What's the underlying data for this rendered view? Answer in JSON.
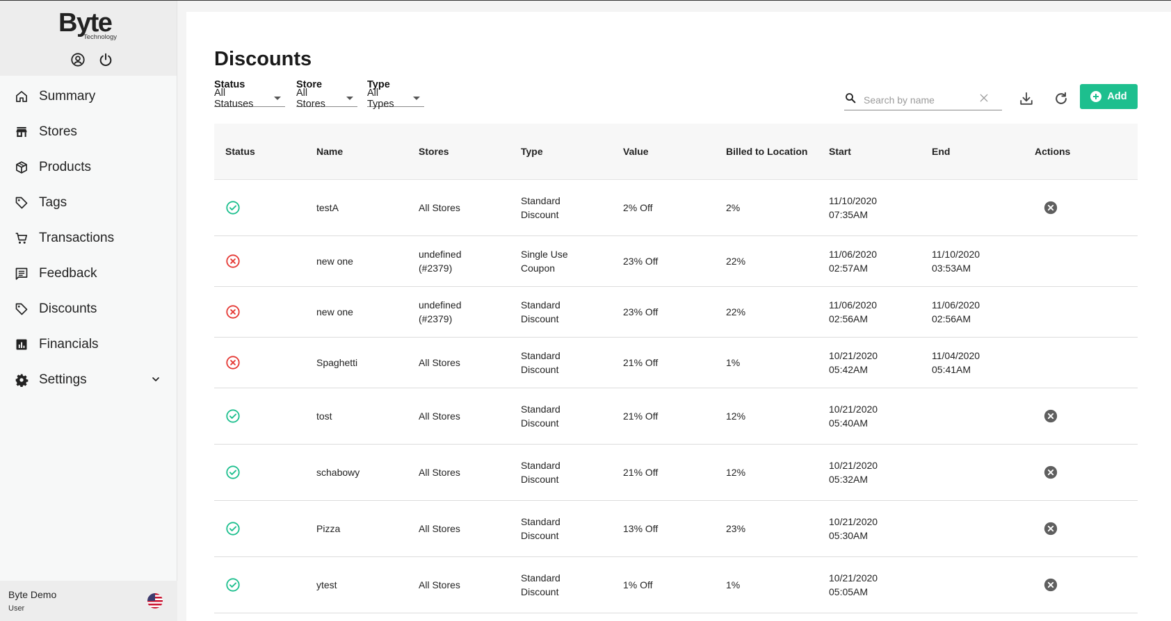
{
  "colors": {
    "accent": "#1dbf8e",
    "active": "#1dbf8e",
    "inactive": "#e53935",
    "action": "#5f5f5f"
  },
  "brand": {
    "name": "Byte",
    "sub": "Technology"
  },
  "sidebar": {
    "items": [
      {
        "label": "Summary",
        "icon": "home-icon"
      },
      {
        "label": "Stores",
        "icon": "store-icon"
      },
      {
        "label": "Products",
        "icon": "box-icon"
      },
      {
        "label": "Tags",
        "icon": "tag-icon"
      },
      {
        "label": "Transactions",
        "icon": "cart-icon"
      },
      {
        "label": "Feedback",
        "icon": "feedback-icon"
      },
      {
        "label": "Discounts",
        "icon": "tag-icon"
      },
      {
        "label": "Financials",
        "icon": "chart-icon"
      },
      {
        "label": "Settings",
        "icon": "gear-icon"
      }
    ],
    "user": {
      "name": "Byte Demo",
      "role": "User"
    }
  },
  "page": {
    "title": "Discounts"
  },
  "filters": {
    "status": {
      "label": "Status",
      "value": "All Statuses"
    },
    "store": {
      "label": "Store",
      "value": "All Stores"
    },
    "type": {
      "label": "Type",
      "value": "All Types"
    }
  },
  "search": {
    "placeholder": "Search by name"
  },
  "add_label": "Add",
  "table": {
    "headers": [
      "Status",
      "Name",
      "Stores",
      "Type",
      "Value",
      "Billed to Location",
      "Start",
      "End",
      "Actions"
    ],
    "rows": [
      {
        "status": "active",
        "name": "testA",
        "stores": "All Stores",
        "type": "Standard Discount",
        "value": "2% Off",
        "billed": "2%",
        "start": "11/10/2020 07:35AM",
        "end": "",
        "action": true
      },
      {
        "status": "inactive",
        "name": "new one",
        "stores": "undefined (#2379)",
        "type": "Single Use Coupon",
        "value": "23% Off",
        "billed": "22%",
        "start": "11/06/2020 02:57AM",
        "end": "11/10/2020 03:53AM",
        "action": false
      },
      {
        "status": "inactive",
        "name": "new one",
        "stores": "undefined (#2379)",
        "type": "Standard Discount",
        "value": "23% Off",
        "billed": "22%",
        "start": "11/06/2020 02:56AM",
        "end": "11/06/2020 02:56AM",
        "action": false
      },
      {
        "status": "inactive",
        "name": "Spaghetti",
        "stores": "All Stores",
        "type": "Standard Discount",
        "value": "21% Off",
        "billed": "1%",
        "start": "10/21/2020 05:42AM",
        "end": "11/04/2020 05:41AM",
        "action": false
      },
      {
        "status": "active",
        "name": "tost",
        "stores": "All Stores",
        "type": "Standard Discount",
        "value": "21% Off",
        "billed": "12%",
        "start": "10/21/2020 05:40AM",
        "end": "",
        "action": true
      },
      {
        "status": "active",
        "name": "schabowy",
        "stores": "All Stores",
        "type": "Standard Discount",
        "value": "21% Off",
        "billed": "12%",
        "start": "10/21/2020 05:32AM",
        "end": "",
        "action": true
      },
      {
        "status": "active",
        "name": "Pizza",
        "stores": "All Stores",
        "type": "Standard Discount",
        "value": "13% Off",
        "billed": "23%",
        "start": "10/21/2020 05:30AM",
        "end": "",
        "action": true
      },
      {
        "status": "active",
        "name": "ytest",
        "stores": "All Stores",
        "type": "Standard Discount",
        "value": "1% Off",
        "billed": "1%",
        "start": "10/21/2020 05:05AM",
        "end": "",
        "action": true
      }
    ]
  }
}
